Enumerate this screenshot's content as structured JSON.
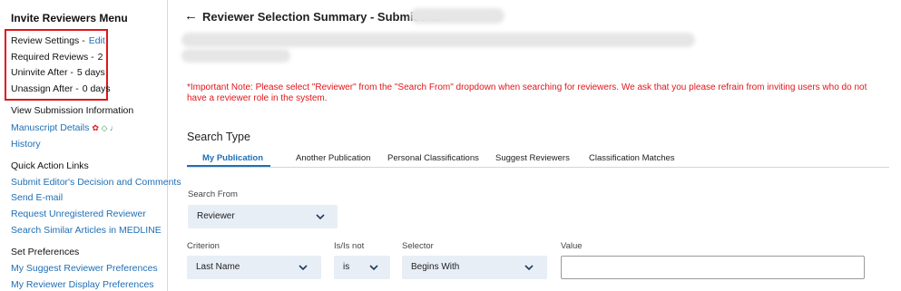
{
  "sidebar": {
    "title": "Invite Reviewers Menu",
    "settings": [
      {
        "label": "Review Settings -",
        "link": "Edit"
      },
      {
        "label": "Required Reviews -",
        "value": "2"
      },
      {
        "label": "Uninvite After -",
        "value": "5 days"
      },
      {
        "label": "Unassign After -",
        "value": "0 days"
      }
    ],
    "view_submission_info": "View Submission Information",
    "manuscript_details": "Manuscript Details",
    "history": "History",
    "quick_action_heading": "Quick Action Links",
    "quick_links": [
      "Submit Editor's Decision and Comments",
      "Send E-mail",
      "Request Unregistered Reviewer",
      "Search Similar Articles in MEDLINE"
    ],
    "preferences_heading": "Set Preferences",
    "preference_links": [
      "My Suggest Reviewer Preferences",
      "My Reviewer Display Preferences"
    ]
  },
  "header": {
    "title": "Reviewer Selection Summary - Submission"
  },
  "important_note": "*Important Note: Please select \"Reviewer\" from the \"Search From\" dropdown when searching for reviewers. We ask that you please refrain from inviting users who do not have a reviewer role in the system.",
  "search": {
    "heading": "Search Type",
    "tabs": [
      "My Publication",
      "Another Publication",
      "Personal Classifications",
      "Suggest Reviewers",
      "Classification Matches"
    ],
    "search_from_label": "Search From",
    "search_from_value": "Reviewer",
    "criterion_label": "Criterion",
    "criterion_value": "Last Name",
    "isnot_label": "Is/Is not",
    "isnot_value": "is",
    "selector_label": "Selector",
    "selector_value": "Begins With",
    "value_label": "Value",
    "value_text": ""
  },
  "colors": {
    "link": "#1f6fb5",
    "warning": "#e0161b",
    "select_bg": "#e8eef6"
  }
}
